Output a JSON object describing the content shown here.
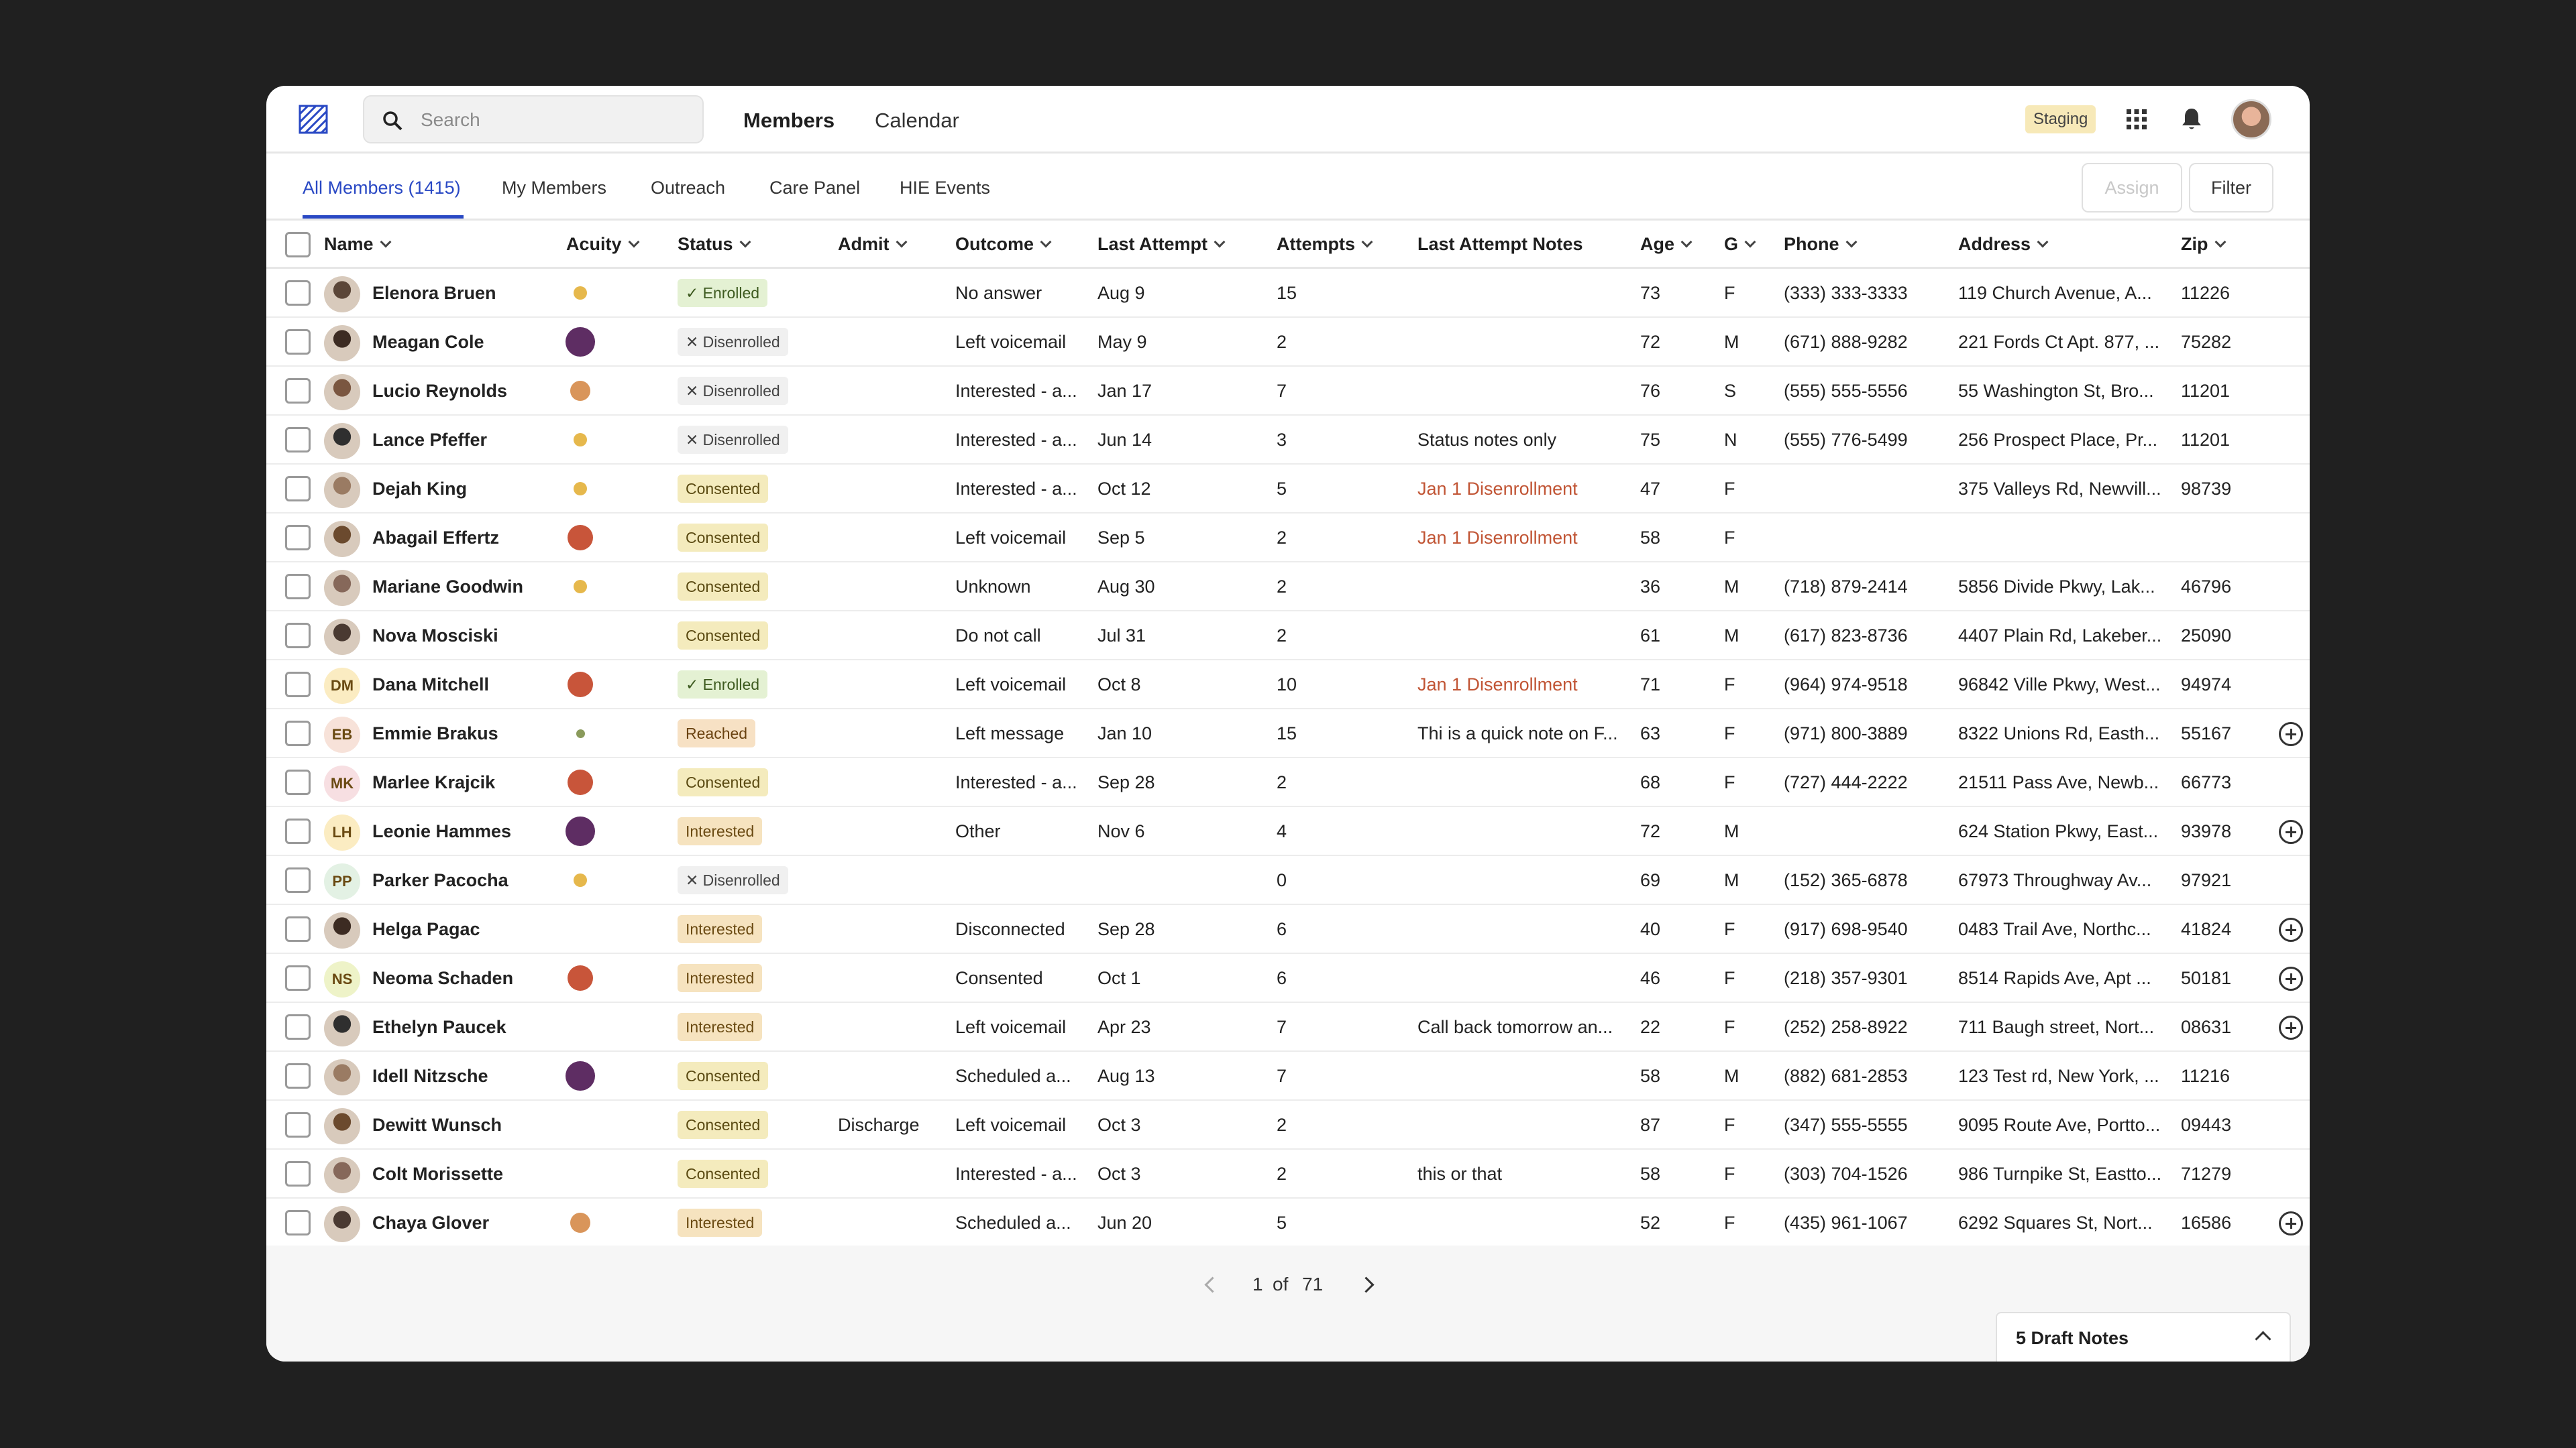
{
  "header": {
    "search_placeholder": "Search",
    "nav": [
      "Members",
      "Calendar"
    ],
    "env_badge": "Staging",
    "icons": [
      "logo-icon",
      "search-icon",
      "apps-grid-icon",
      "bell-icon",
      "user-avatar"
    ]
  },
  "tabs": [
    "All Members (1415)",
    "My Members",
    "Outreach",
    "Care Panel",
    "HIE Events"
  ],
  "actions": {
    "assign": "Assign",
    "filter": "Filter"
  },
  "columns": [
    "Name",
    "Acuity",
    "Status",
    "Admit",
    "Outcome",
    "Last Attempt",
    "Attempts",
    "Last Attempt Notes",
    "Age",
    "G",
    "Phone",
    "Address",
    "Zip"
  ],
  "colors": {
    "accent": "#2948c4",
    "acuity_yellow": "#e6b84c",
    "acuity_orange": "#d9955a",
    "acuity_red": "#c8553a",
    "acuity_purple": "#5e2d63",
    "acuity_olive": "#8a9a5b",
    "note_red": "#c15535"
  },
  "rows": [
    {
      "name": "Elenora Bruen",
      "initials": "",
      "acuity": "yellow-small",
      "status": "Enrolled",
      "admit": "",
      "outcome": "No answer",
      "last_attempt": "Aug 9",
      "attempts": "15",
      "notes": "",
      "notes_red": false,
      "age": "73",
      "g": "F",
      "phone": "(333) 333-3333",
      "address": "119 Church Avenue, A...",
      "zip": "11226",
      "add": false
    },
    {
      "name": "Meagan Cole",
      "initials": "",
      "acuity": "purple",
      "status": "Disenrolled",
      "admit": "",
      "outcome": "Left voicemail",
      "last_attempt": "May 9",
      "attempts": "2",
      "notes": "",
      "notes_red": false,
      "age": "72",
      "g": "M",
      "phone": "(671) 888-9282",
      "address": "221 Fords Ct Apt. 877, ...",
      "zip": "75282",
      "add": false
    },
    {
      "name": "Lucio Reynolds",
      "initials": "",
      "acuity": "orange",
      "status": "Disenrolled",
      "admit": "",
      "outcome": "Interested - a...",
      "last_attempt": "Jan 17",
      "attempts": "7",
      "notes": "",
      "notes_red": false,
      "age": "76",
      "g": "S",
      "phone": "(555) 555-5556",
      "address": "55 Washington St, Bro...",
      "zip": "11201",
      "add": false
    },
    {
      "name": "Lance Pfeffer",
      "initials": "",
      "acuity": "yellow-small",
      "status": "Disenrolled",
      "admit": "",
      "outcome": "Interested - a...",
      "last_attempt": "Jun 14",
      "attempts": "3",
      "notes": "Status notes only",
      "notes_red": false,
      "age": "75",
      "g": "N",
      "phone": "(555) 776-5499",
      "address": "256 Prospect Place, Pr...",
      "zip": "11201",
      "add": false
    },
    {
      "name": "Dejah King",
      "initials": "",
      "acuity": "yellow-small",
      "status": "Consented",
      "admit": "",
      "outcome": "Interested - a...",
      "last_attempt": "Oct 12",
      "attempts": "5",
      "notes": "Jan 1 Disenrollment",
      "notes_red": true,
      "age": "47",
      "g": "F",
      "phone": "",
      "address": "375 Valleys Rd, Newvill...",
      "zip": "98739",
      "add": false
    },
    {
      "name": "Abagail Effertz",
      "initials": "",
      "acuity": "red",
      "status": "Consented",
      "admit": "",
      "outcome": "Left voicemail",
      "last_attempt": "Sep 5",
      "attempts": "2",
      "notes": "Jan 1 Disenrollment",
      "notes_red": true,
      "age": "58",
      "g": "F",
      "phone": "",
      "address": "",
      "zip": "",
      "add": false
    },
    {
      "name": "Mariane Goodwin",
      "initials": "",
      "acuity": "yellow-small",
      "status": "Consented",
      "admit": "",
      "outcome": "Unknown",
      "last_attempt": "Aug 30",
      "attempts": "2",
      "notes": "",
      "notes_red": false,
      "age": "36",
      "g": "M",
      "phone": "(718) 879-2414",
      "address": "5856 Divide Pkwy, Lak...",
      "zip": "46796",
      "add": false
    },
    {
      "name": "Nova Mosciski",
      "initials": "",
      "acuity": "",
      "status": "Consented",
      "admit": "",
      "outcome": "Do not call",
      "last_attempt": "Jul 31",
      "attempts": "2",
      "notes": "",
      "notes_red": false,
      "age": "61",
      "g": "M",
      "phone": "(617) 823-8736",
      "address": "4407 Plain Rd, Lakeber...",
      "zip": "25090",
      "add": false
    },
    {
      "name": "Dana Mitchell",
      "initials": "DM",
      "acuity": "red",
      "status": "Enrolled",
      "admit": "",
      "outcome": "Left voicemail",
      "last_attempt": "Oct 8",
      "attempts": "10",
      "notes": "Jan 1 Disenrollment",
      "notes_red": true,
      "age": "71",
      "g": "F",
      "phone": "(964) 974-9518",
      "address": "96842 Ville Pkwy, West...",
      "zip": "94974",
      "add": false
    },
    {
      "name": "Emmie Brakus",
      "initials": "EB",
      "acuity": "olive-tiny",
      "status": "Reached",
      "admit": "",
      "outcome": "Left message",
      "last_attempt": "Jan 10",
      "attempts": "15",
      "notes": "Thi is a quick note on F...",
      "notes_red": false,
      "age": "63",
      "g": "F",
      "phone": "(971) 800-3889",
      "address": "8322 Unions Rd, Easth...",
      "zip": "55167",
      "add": true
    },
    {
      "name": "Marlee Krajcik",
      "initials": "MK",
      "acuity": "red",
      "status": "Consented",
      "admit": "",
      "outcome": "Interested - a...",
      "last_attempt": "Sep 28",
      "attempts": "2",
      "notes": "",
      "notes_red": false,
      "age": "68",
      "g": "F",
      "phone": "(727) 444-2222",
      "address": "21511 Pass Ave, Newb...",
      "zip": "66773",
      "add": false
    },
    {
      "name": "Leonie Hammes",
      "initials": "LH",
      "acuity": "purple",
      "status": "Interested",
      "admit": "",
      "outcome": "Other",
      "last_attempt": "Nov 6",
      "attempts": "4",
      "notes": "",
      "notes_red": false,
      "age": "72",
      "g": "M",
      "phone": "",
      "address": "624 Station Pkwy, East...",
      "zip": "93978",
      "add": true
    },
    {
      "name": "Parker Pacocha",
      "initials": "PP",
      "acuity": "yellow-small",
      "status": "Disenrolled",
      "admit": "",
      "outcome": "",
      "last_attempt": "",
      "attempts": "0",
      "notes": "",
      "notes_red": false,
      "age": "69",
      "g": "M",
      "phone": "(152) 365-6878",
      "address": "67973 Throughway Av...",
      "zip": "97921",
      "add": false
    },
    {
      "name": "Helga Pagac",
      "initials": "",
      "acuity": "",
      "status": "Interested",
      "admit": "",
      "outcome": "Disconnected",
      "last_attempt": "Sep 28",
      "attempts": "6",
      "notes": "",
      "notes_red": false,
      "age": "40",
      "g": "F",
      "phone": "(917) 698-9540",
      "address": "0483 Trail Ave, Northc...",
      "zip": "41824",
      "add": true
    },
    {
      "name": "Neoma Schaden",
      "initials": "NS",
      "acuity": "red",
      "status": "Interested",
      "admit": "",
      "outcome": "Consented",
      "last_attempt": "Oct 1",
      "attempts": "6",
      "notes": "",
      "notes_red": false,
      "age": "46",
      "g": "F",
      "phone": "(218) 357-9301",
      "address": "8514 Rapids Ave, Apt ...",
      "zip": "50181",
      "add": true
    },
    {
      "name": "Ethelyn Paucek",
      "initials": "",
      "acuity": "",
      "status": "Interested",
      "admit": "",
      "outcome": "Left voicemail",
      "last_attempt": "Apr 23",
      "attempts": "7",
      "notes": "Call back tomorrow an...",
      "notes_red": false,
      "age": "22",
      "g": "F",
      "phone": "(252) 258-8922",
      "address": "711 Baugh street, Nort...",
      "zip": "08631",
      "add": true
    },
    {
      "name": "Idell Nitzsche",
      "initials": "",
      "acuity": "purple",
      "status": "Consented",
      "admit": "",
      "outcome": "Scheduled a...",
      "last_attempt": "Aug 13",
      "attempts": "7",
      "notes": "",
      "notes_red": false,
      "age": "58",
      "g": "M",
      "phone": "(882) 681-2853",
      "address": "123 Test rd, New York, ...",
      "zip": "11216",
      "add": false
    },
    {
      "name": "Dewitt Wunsch",
      "initials": "",
      "acuity": "",
      "status": "Consented",
      "admit": "Discharge",
      "outcome": "Left voicemail",
      "last_attempt": "Oct 3",
      "attempts": "2",
      "notes": "",
      "notes_red": false,
      "age": "87",
      "g": "F",
      "phone": "(347) 555-5555",
      "address": "9095 Route Ave, Portto...",
      "zip": "09443",
      "add": false
    },
    {
      "name": "Colt Morissette",
      "initials": "",
      "acuity": "",
      "status": "Consented",
      "admit": "",
      "outcome": "Interested - a...",
      "last_attempt": "Oct 3",
      "attempts": "2",
      "notes": "this or that",
      "notes_red": false,
      "age": "58",
      "g": "F",
      "phone": "(303) 704-1526",
      "address": "986 Turnpike St, Eastto...",
      "zip": "71279",
      "add": false
    },
    {
      "name": "Chaya Glover",
      "initials": "",
      "acuity": "orange",
      "status": "Interested",
      "admit": "",
      "outcome": "Scheduled a...",
      "last_attempt": "Jun 20",
      "attempts": "5",
      "notes": "",
      "notes_red": false,
      "age": "52",
      "g": "F",
      "phone": "(435) 961-1067",
      "address": "6292 Squares St, Nort...",
      "zip": "16586",
      "add": true
    }
  ],
  "pagination": {
    "current": "1",
    "of_label": "of",
    "total": "71"
  },
  "drafts": {
    "label": "5 Draft Notes"
  }
}
